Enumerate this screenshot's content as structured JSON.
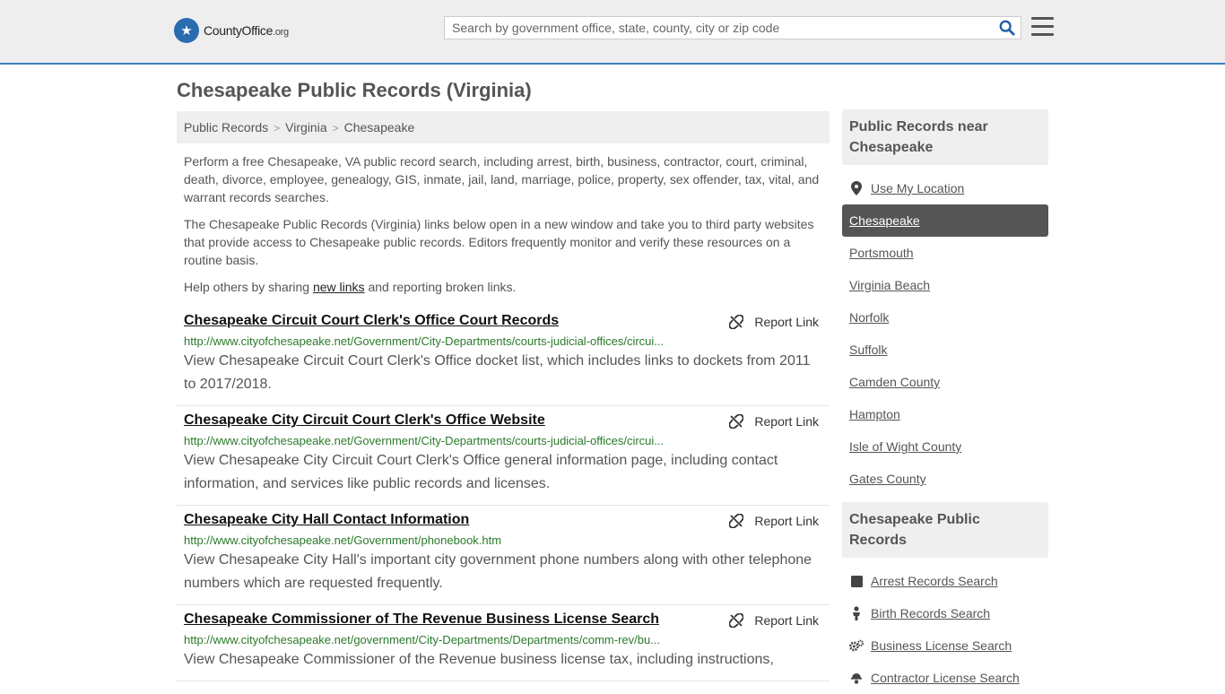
{
  "header": {
    "brand": "CountyOffice",
    "brand_tld": ".org",
    "search_placeholder": "Search by government office, state, county, city or zip code"
  },
  "page_title": "Chesapeake Public Records (Virginia)",
  "breadcrumb": [
    "Public Records",
    "Virginia",
    "Chesapeake"
  ],
  "intro": {
    "p1": "Perform a free Chesapeake, VA public record search, including arrest, birth, business, contractor, court, criminal, death, divorce, employee, genealogy, GIS, inmate, jail, land, marriage, police, property, sex offender, tax, vital, and warrant records searches.",
    "p2": "The Chesapeake Public Records (Virginia) links below open in a new window and take you to third party websites that provide access to Chesapeake public records. Editors frequently monitor and verify these resources on a routine basis.",
    "p3_before": "Help others by sharing ",
    "p3_link": "new links",
    "p3_after": " and reporting broken links."
  },
  "report_label": "Report Link",
  "results": [
    {
      "title": "Chesapeake Circuit Court Clerk's Office Court Records",
      "url": "http://www.cityofchesapeake.net/Government/City-Departments/courts-judicial-offices/circui...",
      "desc": "View Chesapeake Circuit Court Clerk's Office docket list, which includes links to dockets from 2011 to 2017/2018."
    },
    {
      "title": "Chesapeake City Circuit Court Clerk's Office Website",
      "url": "http://www.cityofchesapeake.net/Government/City-Departments/courts-judicial-offices/circui...",
      "desc": "View Chesapeake City Circuit Court Clerk's Office general information page, including contact information, and services like public records and licenses."
    },
    {
      "title": "Chesapeake City Hall Contact Information",
      "url": "http://www.cityofchesapeake.net/Government/phonebook.htm",
      "desc": "View Chesapeake City Hall's important city government phone numbers along with other telephone numbers which are requested frequently."
    },
    {
      "title": "Chesapeake Commissioner of The Revenue Business License Search",
      "url": "http://www.cityofchesapeake.net/government/City-Departments/Departments/comm-rev/bu...",
      "desc": "View Chesapeake Commissioner of the Revenue business license tax, including instructions,"
    }
  ],
  "sidebar": {
    "near_heading": "Public Records near Chesapeake",
    "use_location": "Use My Location",
    "nearby": [
      "Chesapeake",
      "Portsmouth",
      "Virginia Beach",
      "Norfolk",
      "Suffolk",
      "Camden County",
      "Hampton",
      "Isle of Wight County",
      "Gates County"
    ],
    "records_heading": "Chesapeake Public Records",
    "records": [
      {
        "label": "Arrest Records Search",
        "icon": "square-icon"
      },
      {
        "label": "Birth Records Search",
        "icon": "baby-icon"
      },
      {
        "label": "Business License Search",
        "icon": "gears-icon"
      },
      {
        "label": "Contractor License Search",
        "icon": "contractor-icon"
      }
    ]
  }
}
